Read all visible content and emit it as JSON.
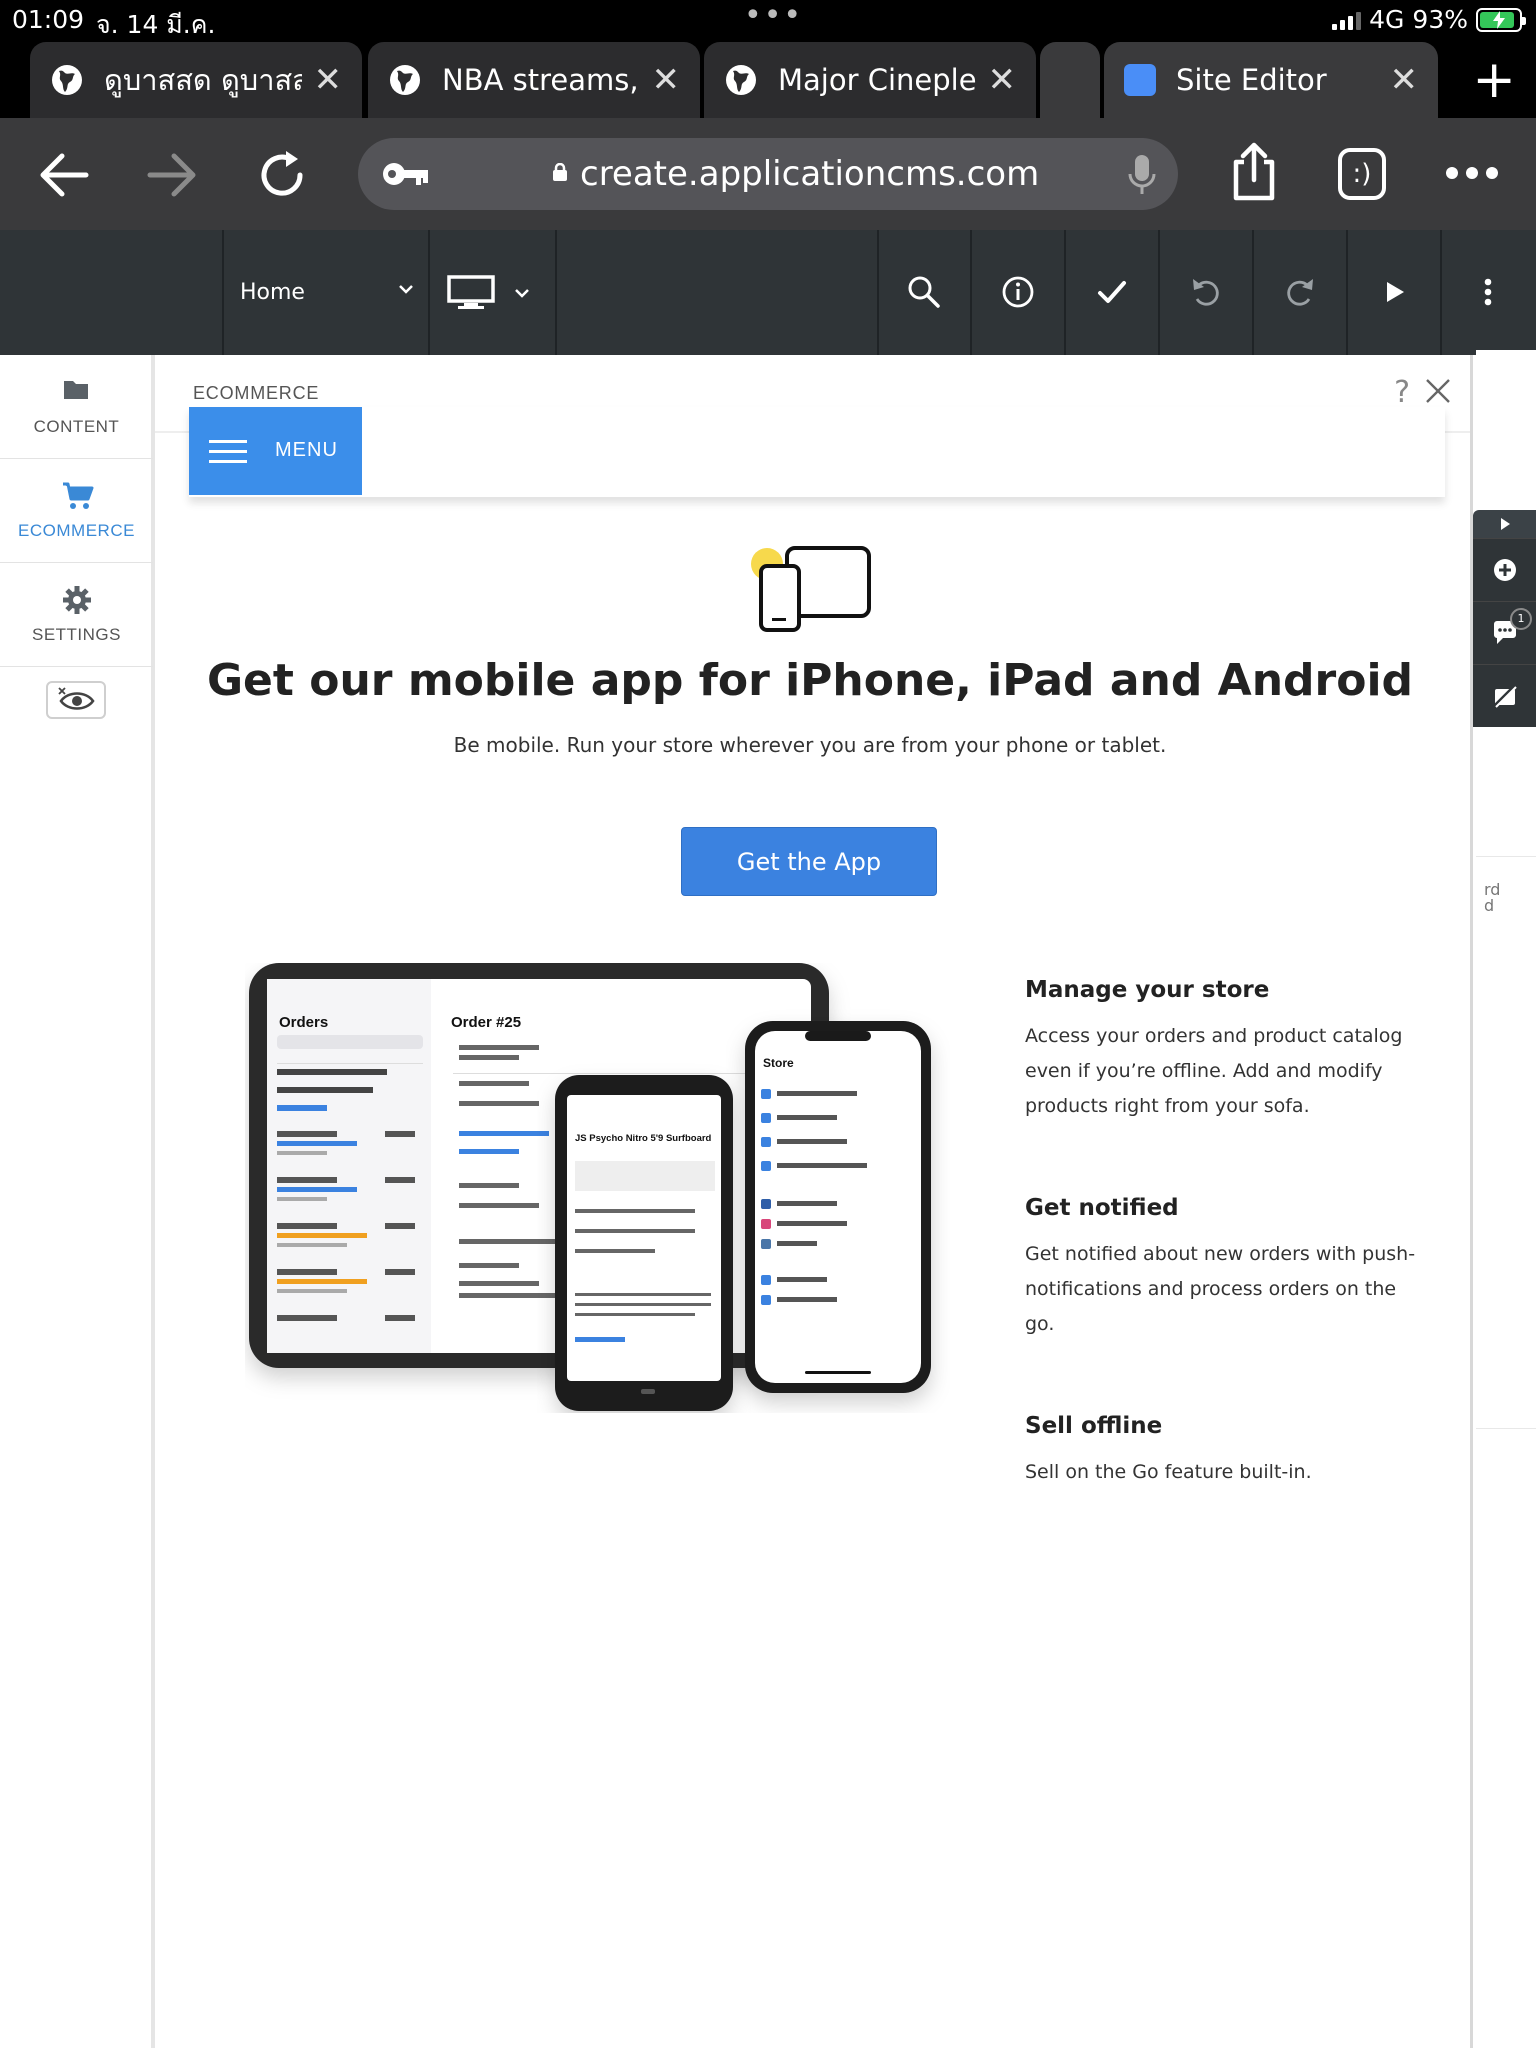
{
  "status_bar": {
    "time": "01:09",
    "date": "จ. 14 มี.ค.",
    "network": "4G",
    "battery": "93%",
    "battery_level_percent": 93
  },
  "tabs": [
    {
      "title": "ดูบาสสด ดูบาสสด",
      "icon": "globe-icon"
    },
    {
      "title": "NBA streams, NBA",
      "icon": "globe-icon"
    },
    {
      "title": "Major Cineplex",
      "icon": "globe-icon"
    },
    {
      "title": "Site Editor",
      "icon": "site-favicon",
      "active": true
    }
  ],
  "address_bar": {
    "url": "create.applicationcms.com",
    "tab_switcher_label": ":)"
  },
  "editor_toolbar": {
    "page_selector": "Home",
    "device": "desktop-icon"
  },
  "sidebar": {
    "items": [
      {
        "label": "CONTENT",
        "icon": "folder-icon"
      },
      {
        "label": "ECOMMERCE",
        "icon": "cart-icon",
        "active": true
      },
      {
        "label": "SETTINGS",
        "icon": "gear-icon"
      }
    ]
  },
  "panel": {
    "section_label": "ECOMMERCE",
    "help": "?",
    "menu_label": "MENU",
    "headline": "Get our mobile app for iPhone, iPad and Android",
    "subline": "Be mobile. Run your store wherever you are from your phone or tablet.",
    "cta": "Get the App",
    "features": [
      {
        "title": "Manage your store",
        "description": "Access your orders and product catalog even if you’re offline. Add and modify products right from your sofa."
      },
      {
        "title": "Get notified",
        "description": "Get notified about new orders with push-notifications and process orders on the go."
      },
      {
        "title": "Sell offline",
        "description": "Sell on the Go feature built-in."
      }
    ]
  },
  "mockup": {
    "tablet_title": "Orders",
    "tablet_order": "Order #25",
    "phone_product": "JS Psycho Nitro 5'9 Surfboard",
    "phone2_title": "Store"
  },
  "floating_widget": {
    "comment_count": "1"
  },
  "background_peek_text": "rd\nd",
  "colors": {
    "accent": "#3b8eea",
    "toolbar": "#2f3437",
    "browser_bar": "#3a3a3c"
  }
}
